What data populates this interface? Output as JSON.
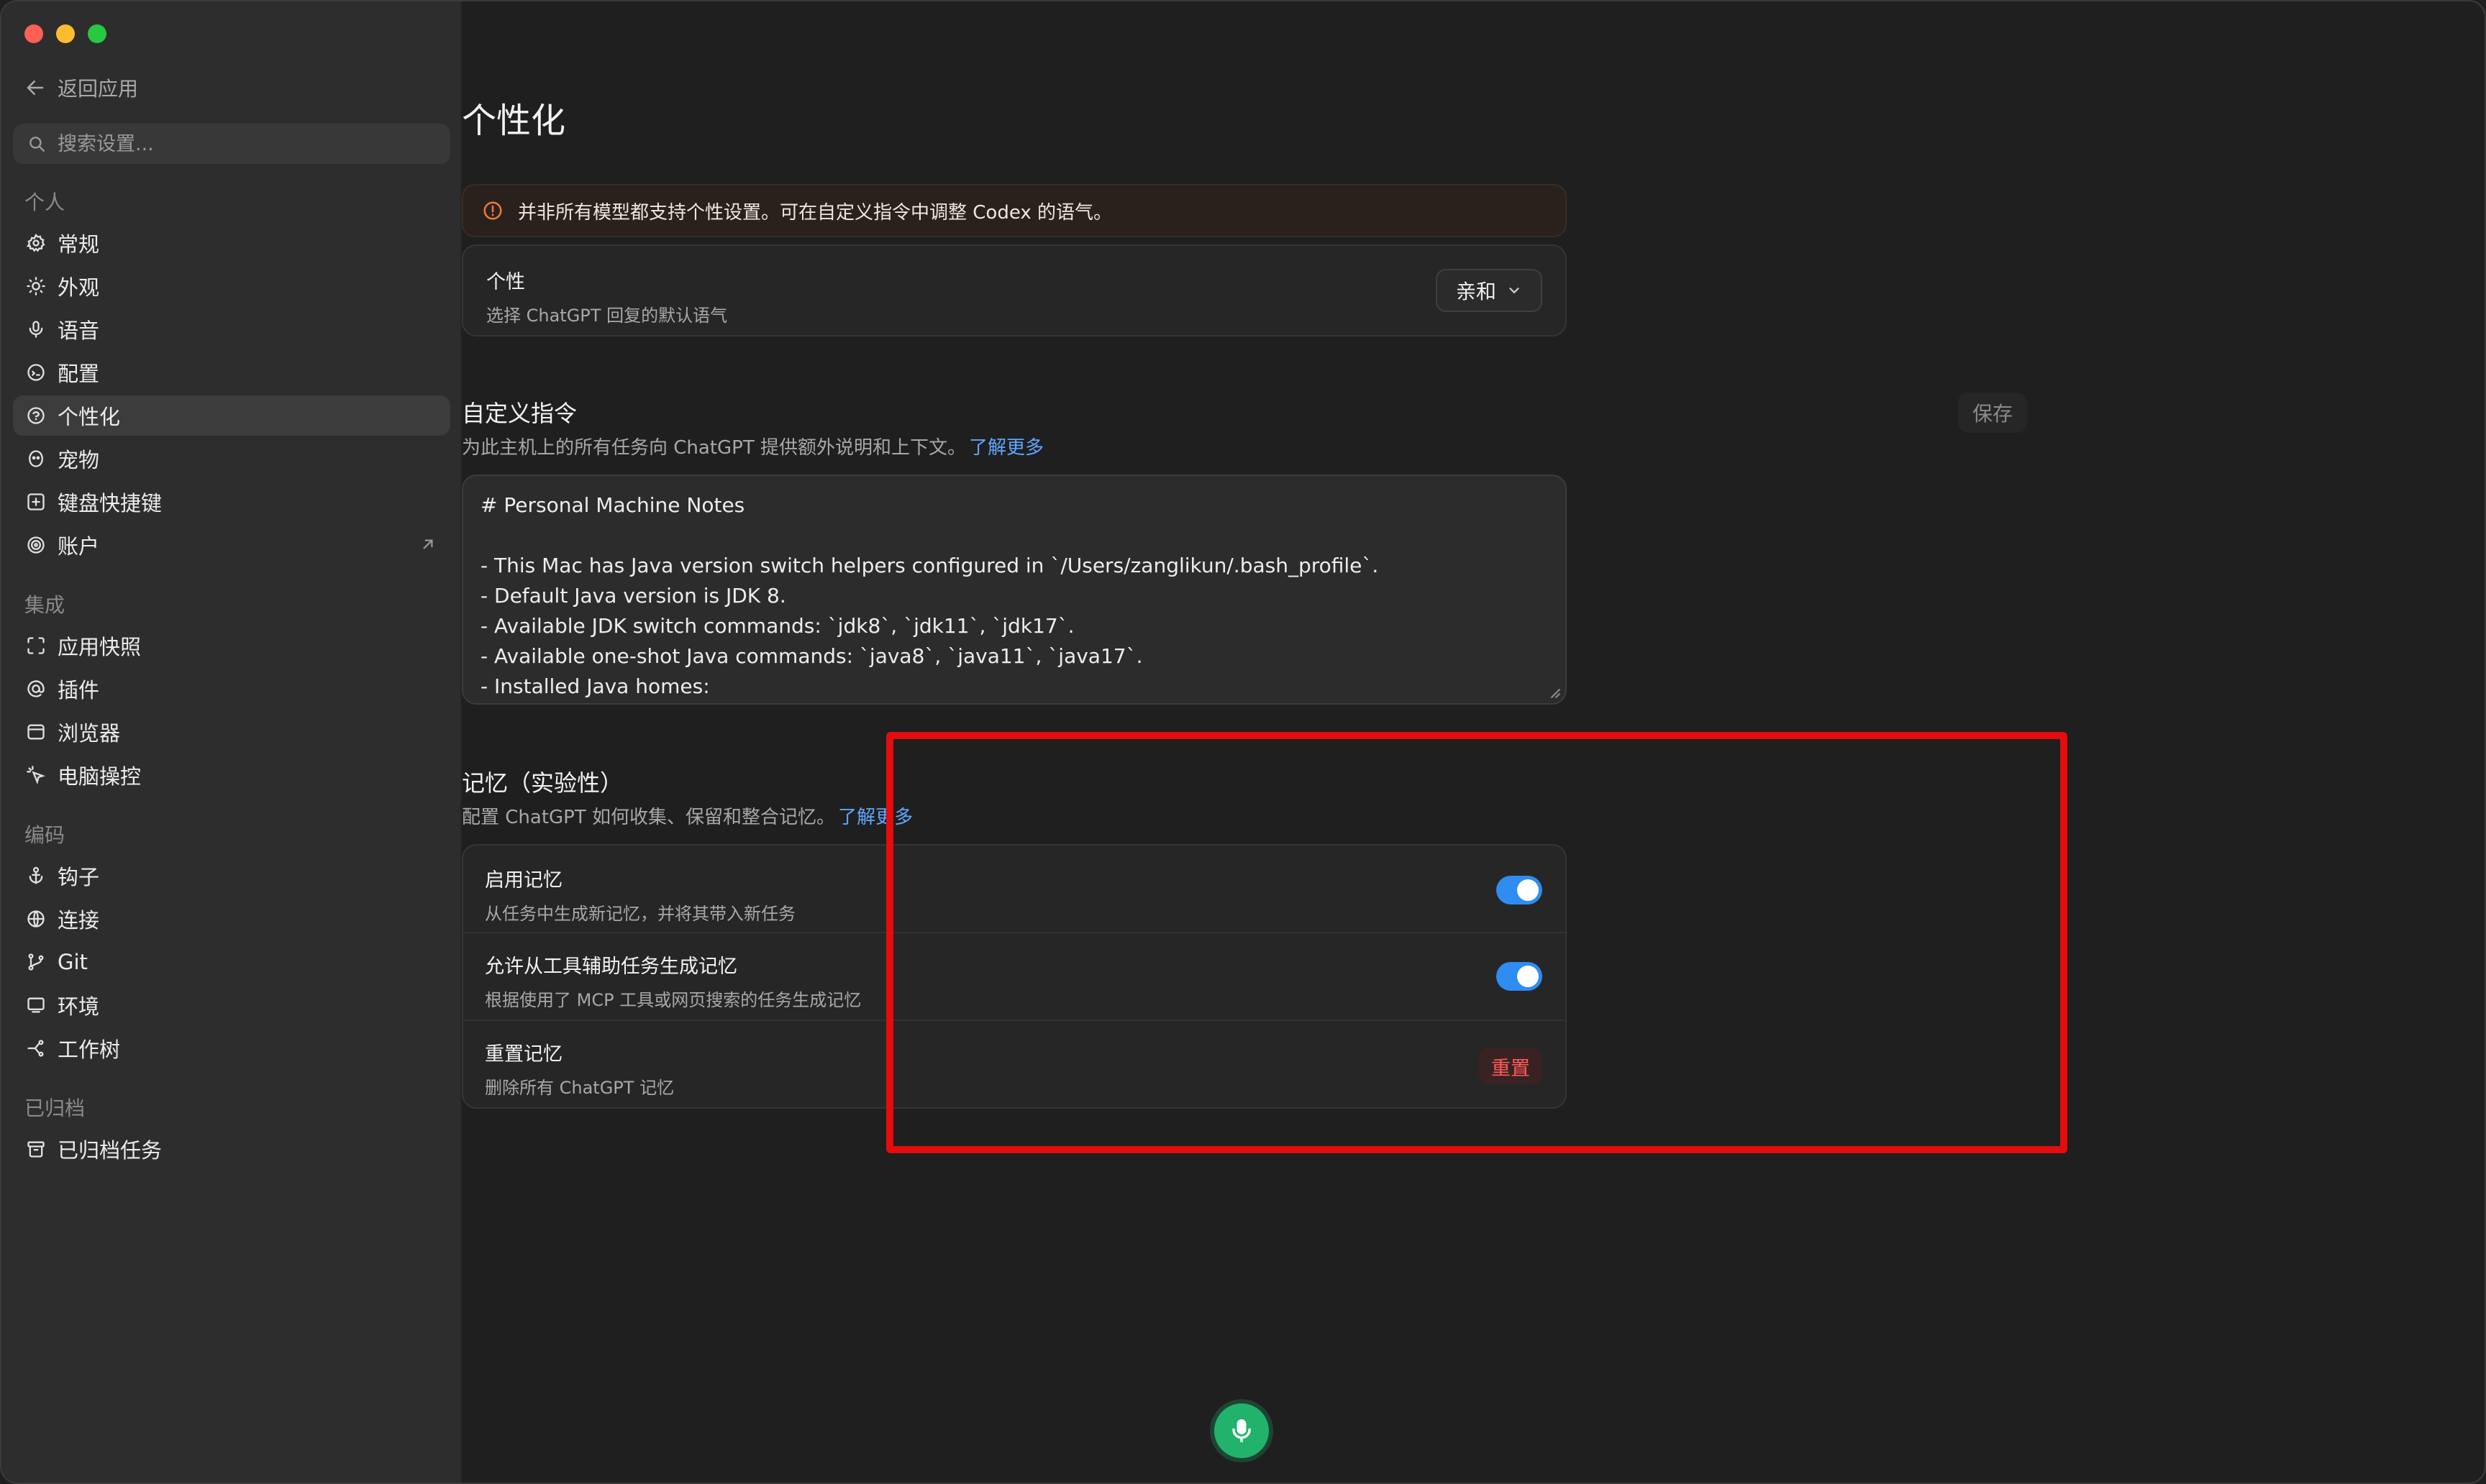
{
  "sidebar": {
    "back_label": "返回应用",
    "search_placeholder": "搜索设置...",
    "sections": {
      "personal": "个人",
      "integration": "集成",
      "coding": "编码",
      "archived": "已归档"
    },
    "personal_items": [
      {
        "label": "常规",
        "icon": "gear-icon"
      },
      {
        "label": "外观",
        "icon": "sun-icon"
      },
      {
        "label": "语音",
        "icon": "microphone-icon"
      },
      {
        "label": "配置",
        "icon": "config-icon"
      },
      {
        "label": "个性化",
        "icon": "personalization-icon"
      },
      {
        "label": "宠物",
        "icon": "pet-icon"
      },
      {
        "label": "键盘快捷键",
        "icon": "keyboard-icon"
      },
      {
        "label": "账户",
        "icon": "account-icon"
      }
    ],
    "integration_items": [
      {
        "label": "应用快照",
        "icon": "snapshot-icon"
      },
      {
        "label": "插件",
        "icon": "plugin-icon"
      },
      {
        "label": "浏览器",
        "icon": "browser-icon"
      },
      {
        "label": "电脑操控",
        "icon": "computer-control-icon"
      }
    ],
    "coding_items": [
      {
        "label": "钩子",
        "icon": "anchor-icon"
      },
      {
        "label": "连接",
        "icon": "globe-icon"
      },
      {
        "label": "Git",
        "icon": "git-branch-icon"
      },
      {
        "label": "环境",
        "icon": "monitor-icon"
      },
      {
        "label": "工作树",
        "icon": "worktree-icon"
      }
    ],
    "archived_items": [
      {
        "label": "已归档任务",
        "icon": "archive-icon"
      }
    ]
  },
  "main": {
    "title": "个性化",
    "banner": "并非所有模型都支持个性设置。可在自定义指令中调整 Codex 的语气。",
    "personality": {
      "title": "个性",
      "subtitle": "选择 ChatGPT 回复的默认语气",
      "selected": "亲和"
    },
    "custom_instructions": {
      "title": "自定义指令",
      "subtitle": "为此主机上的所有任务向 ChatGPT 提供额外说明和上下文。",
      "link": "了解更多",
      "save_label": "保存",
      "lines": [
        "# Personal Machine Notes",
        "",
        "- This Mac has Java version switch helpers configured in `/Users/zanglikun/.bash_profile`.",
        "- Default Java version is JDK 8.",
        "- Available JDK switch commands: `jdk8`, `jdk11`, `jdk17`.",
        "- Available one-shot Java commands: `java8`, `java11`, `java17`.",
        "- Installed Java homes:"
      ]
    },
    "memory": {
      "title": "记忆（实验性）",
      "subtitle": "配置 ChatGPT 如何收集、保留和整合记忆。",
      "link": "了解更多",
      "rows": [
        {
          "title": "启用记忆",
          "subtitle": "从任务中生成新记忆，并将其带入新任务",
          "enabled": true
        },
        {
          "title": "允许从工具辅助任务生成记忆",
          "subtitle": "根据使用了 MCP 工具或网页搜索的任务生成记忆",
          "enabled": true
        },
        {
          "title": "重置记忆",
          "subtitle": "删除所有 ChatGPT 记忆",
          "button": "重置"
        }
      ]
    }
  },
  "colors": {
    "accent": "#2f8cf0",
    "highlight": "#e40c0c",
    "danger": "#ff5a5a",
    "mic": "#21b36c"
  }
}
